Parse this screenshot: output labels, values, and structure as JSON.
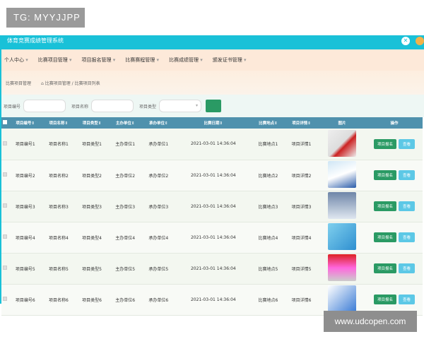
{
  "watermarks": {
    "top_left": "TG: MYYJJPP",
    "bottom_right": "www.udcopen.com"
  },
  "header": {
    "title": "体育竞赛成绩管理系统"
  },
  "nav": [
    "个人中心",
    "比赛项目管理",
    "项目报名管理",
    "比赛赛程管理",
    "比赛成绩管理",
    "颁发证书管理"
  ],
  "breadcrumb": {
    "title": "比赛项目管理",
    "path": "比赛项目管理 / 比赛项目列表"
  },
  "search": {
    "label1": "项目编号",
    "label2": "项目名称",
    "label3": "项目类型",
    "select_arrow": "▾"
  },
  "table": {
    "headers": [
      "项目编号",
      "项目名称",
      "项目类型",
      "主办单位",
      "承办单位",
      "比赛日期",
      "比赛地点",
      "项目详情",
      "图片",
      "操作"
    ],
    "rows": [
      [
        "项目编号1",
        "项目名称1",
        "项目类型1",
        "主办单位1",
        "承办单位1",
        "2021-03-01 14:36:04",
        "比赛地点1",
        "项目详情1"
      ],
      [
        "项目编号2",
        "项目名称2",
        "项目类型2",
        "主办单位2",
        "承办单位2",
        "2021-03-01 14:36:04",
        "比赛地点2",
        "项目详情2"
      ],
      [
        "项目编号3",
        "项目名称3",
        "项目类型3",
        "主办单位3",
        "承办单位3",
        "2021-03-01 14:36:04",
        "比赛地点3",
        "项目详情3"
      ],
      [
        "项目编号4",
        "项目名称4",
        "项目类型4",
        "主办单位4",
        "承办单位4",
        "2021-03-01 14:36:04",
        "比赛地点4",
        "项目详情4"
      ],
      [
        "项目编号5",
        "项目名称5",
        "项目类型5",
        "主办单位5",
        "承办单位5",
        "2021-03-01 14:36:04",
        "比赛地点5",
        "项目详情5"
      ],
      [
        "项目编号6",
        "项目名称6",
        "项目类型6",
        "主办单位6",
        "承办单位6",
        "2021-03-01 14:36:04",
        "比赛地点6",
        "项目详情6"
      ]
    ],
    "actions": {
      "register": "项目报名",
      "view": "查看"
    }
  },
  "colors": {
    "header": "#19c1d8",
    "nav": "#fde9d9",
    "table_header": "#4f91ad",
    "primary_button": "#2a9a64",
    "secondary_button": "#5cc8e6"
  }
}
